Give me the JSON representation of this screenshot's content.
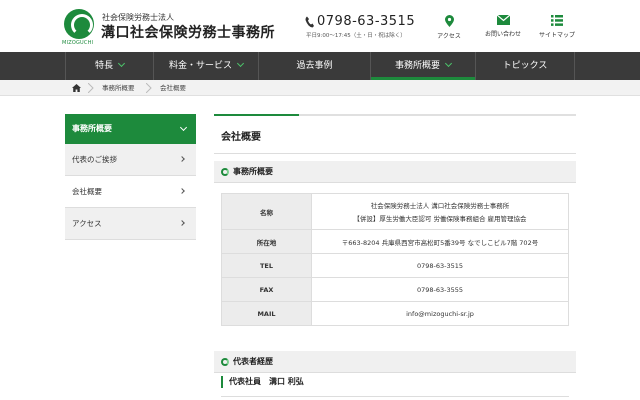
{
  "header": {
    "logo_text": "MIZOGUCHI",
    "firm_small": "社会保険労務士法人",
    "firm_name": "溝口社会保険労務士事務所",
    "phone": "0798-63-3515",
    "hours": "平日9:00〜17:45（土・日・祝は除く）",
    "tools": [
      {
        "label": "アクセス",
        "icon": "map-pin-icon"
      },
      {
        "label": "お問い合わせ",
        "icon": "mail-icon"
      },
      {
        "label": "サイトマップ",
        "icon": "list-icon"
      }
    ]
  },
  "nav": {
    "items": [
      {
        "label": "特長"
      },
      {
        "label": "料金・サービス"
      },
      {
        "label": "過去事例"
      },
      {
        "label": "事務所概要"
      },
      {
        "label": "トピックス"
      }
    ]
  },
  "breadcrumb": {
    "home_icon": "home-icon",
    "items": [
      "事務所概要",
      "会社概要"
    ]
  },
  "sidebar": {
    "title": "事務所概要",
    "items": [
      {
        "label": "代表のご挨拶"
      },
      {
        "label": "会社概要"
      },
      {
        "label": "アクセス"
      }
    ]
  },
  "main": {
    "title": "会社概要",
    "section1": "事務所概要",
    "table": {
      "rows": [
        {
          "label": "名称",
          "value_lines": [
            "社会保険労務士法人 溝口社会保険労務士事務所",
            "【併設】厚生労働大臣認可 労働保険事務組合 雇用管理協会"
          ]
        },
        {
          "label": "所在地",
          "value_lines": [
            "〒663-8204 兵庫県西宮市高松町5番39号 なでしこビル7階 702号"
          ]
        },
        {
          "label": "TEL",
          "value_lines": [
            "0798-63-3515"
          ]
        },
        {
          "label": "FAX",
          "value_lines": [
            "0798-63-3555"
          ]
        },
        {
          "label": "MAIL",
          "value_lines": [
            "info@mizoguchi-sr.jp"
          ]
        }
      ]
    },
    "section2": "代表者経歴",
    "person": "代表社員　溝口 利弘"
  },
  "colors": {
    "brand": "#1d8a3c",
    "nav_bg": "#3a3a3a",
    "accent_light": "#4cc46b"
  }
}
